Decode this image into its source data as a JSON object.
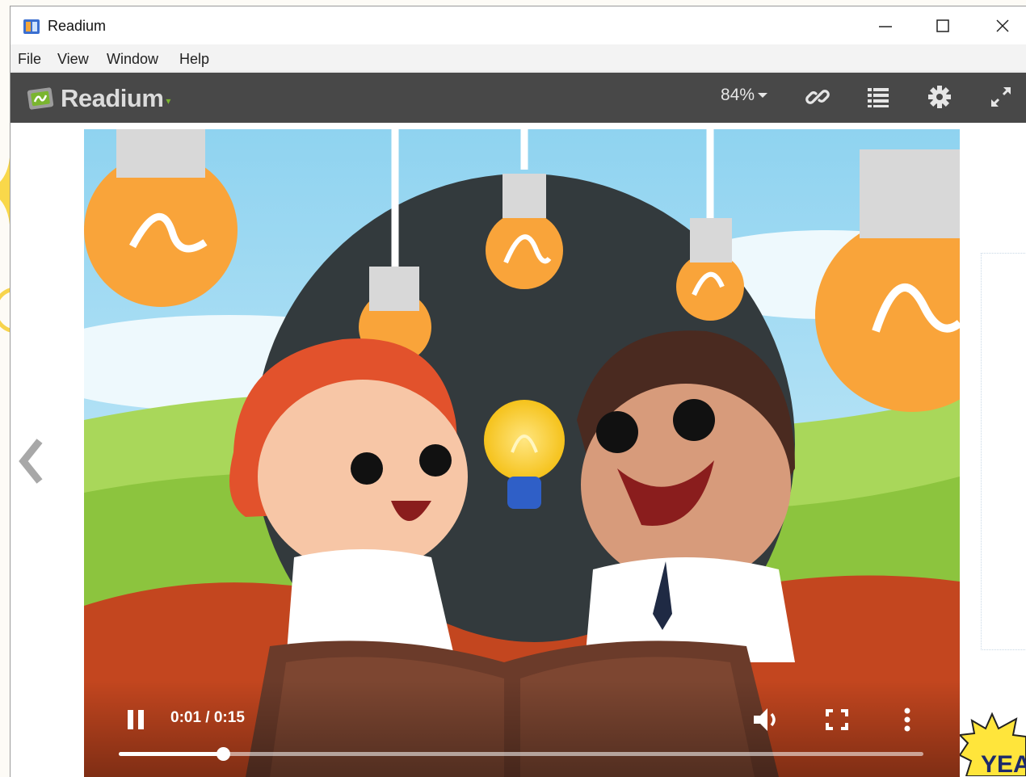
{
  "window": {
    "title": "Readium",
    "minimize_icon": "minimize-icon",
    "maximize_icon": "maximize-icon",
    "close_icon": "close-icon"
  },
  "menu": [
    {
      "label": "File"
    },
    {
      "label": "View"
    },
    {
      "label": "Window"
    },
    {
      "label": "Help"
    }
  ],
  "toolbar": {
    "brand": "Readium",
    "zoom": "84%",
    "icons": [
      "link-icon",
      "list-icon",
      "gear-icon",
      "fullscreen-icon"
    ]
  },
  "video": {
    "time": "0:01 / 0:15",
    "progress": 0.13,
    "icons": [
      "pause-icon",
      "volume-icon",
      "fullscreen-icon",
      "more-vert-icon"
    ]
  },
  "navigation": {
    "prev": "chevron-left-icon",
    "next": "chevron-right-icon"
  },
  "decoration": {
    "sticker_text": "YEA"
  },
  "colors": {
    "toolbar": "#484848",
    "accent": "#7ab52f",
    "bulb": "#f9a43a"
  }
}
